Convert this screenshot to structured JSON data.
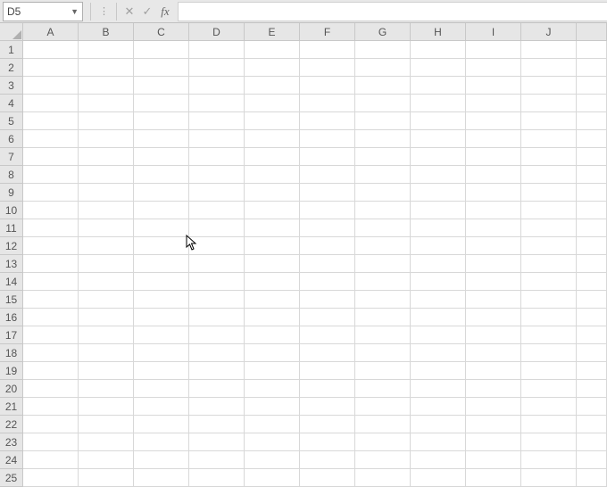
{
  "formula_bar": {
    "name_box_value": "D5",
    "cancel_symbol": "✕",
    "enter_symbol": "✓",
    "fx_label": "fx",
    "formula_value": ""
  },
  "columns": [
    "A",
    "B",
    "C",
    "D",
    "E",
    "F",
    "G",
    "H",
    "I",
    "J"
  ],
  "rows": [
    "1",
    "2",
    "3",
    "4",
    "5",
    "6",
    "7",
    "8",
    "9",
    "10",
    "11",
    "12",
    "13",
    "14",
    "15",
    "16",
    "17",
    "18",
    "19",
    "20",
    "21",
    "22",
    "23",
    "24",
    "25"
  ]
}
